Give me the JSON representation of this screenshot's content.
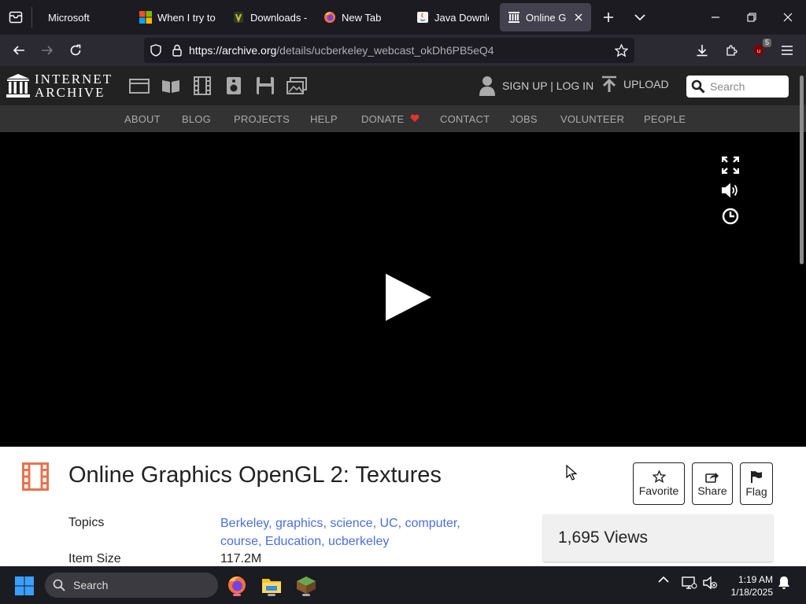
{
  "browser": {
    "tabs": [
      {
        "title": "Microsoft",
        "icon": "inbox-icon"
      },
      {
        "title": "When I try to a",
        "icon": "microsoft-logo-icon"
      },
      {
        "title": "Downloads - E",
        "icon": "minecraft-icon"
      },
      {
        "title": "New Tab",
        "icon": "firefox-icon"
      },
      {
        "title": "Java Downloa",
        "icon": "java-icon"
      },
      {
        "title": "Online Grap",
        "icon": "archive-icon",
        "active": true
      }
    ],
    "url_host": "https://archive.org",
    "url_path": "/details/ucberkeley_webcast_okDh6PB5eQ4",
    "ublock_badge": "5"
  },
  "ia": {
    "logo_line1": "INTERNET",
    "logo_line2": "ARCHIVE",
    "signup": "SIGN UP | LOG IN",
    "upload": "UPLOAD",
    "search_placeholder": "Search",
    "nav": [
      "ABOUT",
      "BLOG",
      "PROJECTS",
      "HELP",
      "DONATE",
      "CONTACT",
      "JOBS",
      "VOLUNTEER",
      "PEOPLE"
    ],
    "accent": "#e8312f"
  },
  "item": {
    "title": "Online Graphics OpenGL 2: Textures",
    "actions": {
      "favorite": "Favorite",
      "share": "Share",
      "flag": "Flag"
    },
    "topics_label": "Topics",
    "topics": [
      "Berkeley",
      "graphics",
      "science",
      "UC",
      "computer",
      "course",
      "Education",
      "ucberkeley"
    ],
    "size_label": "Item Size",
    "size_value": "117.2M",
    "views": "1,695 Views"
  },
  "taskbar": {
    "search": "Search",
    "time": "1:19 AM",
    "date": "1/18/2025"
  }
}
